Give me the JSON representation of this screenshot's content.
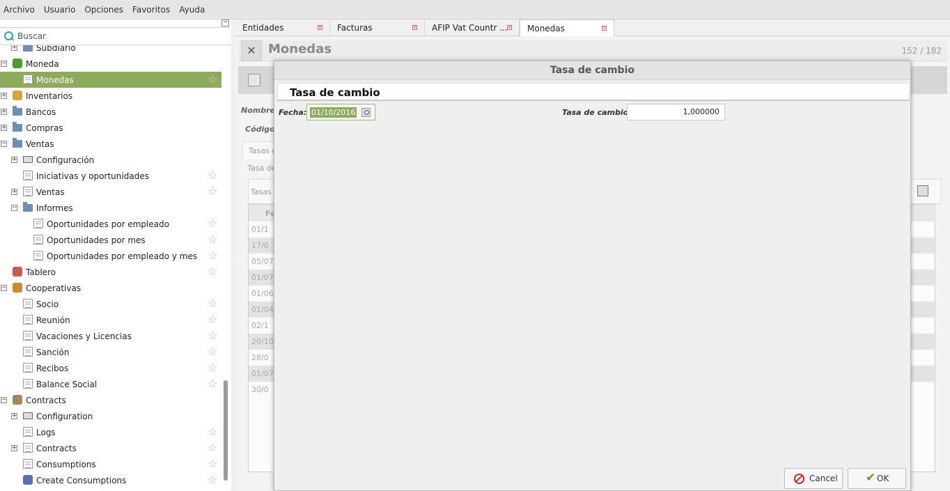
{
  "menu": [
    "Archivo",
    "Usuario",
    "Opciones",
    "Favoritos",
    "Ayuda"
  ],
  "sidebar": {
    "collapse_label": "−",
    "search_placeholder": "Buscar",
    "items": [
      {
        "label": "Subdiario",
        "level": 1,
        "expander": "+",
        "icon": "folder-icon",
        "star": false
      },
      {
        "label": "Moneda",
        "level": 0,
        "expander": "−",
        "icon": "currency-icon",
        "star": false
      },
      {
        "label": "Monedas",
        "level": 1,
        "expander": "",
        "icon": "document-icon",
        "star": true,
        "selected": true
      },
      {
        "label": "Inventarios",
        "level": 0,
        "expander": "+",
        "icon": "box-icon",
        "star": false
      },
      {
        "label": "Bancos",
        "level": 0,
        "expander": "+",
        "icon": "folder-icon",
        "star": false
      },
      {
        "label": "Compras",
        "level": 0,
        "expander": "+",
        "icon": "folder-icon",
        "star": false
      },
      {
        "label": "Ventas",
        "level": 0,
        "expander": "−",
        "icon": "folder-icon",
        "star": false
      },
      {
        "label": "Configuración",
        "level": 1,
        "expander": "+",
        "icon": "config-icon",
        "star": false
      },
      {
        "label": "Iniciativas y oportunidades",
        "level": 1,
        "expander": "",
        "icon": "document-icon",
        "star": true
      },
      {
        "label": "Ventas",
        "level": 1,
        "expander": "+",
        "icon": "document-icon",
        "star": true
      },
      {
        "label": "Informes",
        "level": 1,
        "expander": "−",
        "icon": "folder-icon",
        "star": false
      },
      {
        "label": "Oportunidades por empleado",
        "level": 2,
        "expander": "",
        "icon": "document-icon",
        "star": true
      },
      {
        "label": "Oportunidades por mes",
        "level": 2,
        "expander": "",
        "icon": "document-icon",
        "star": true
      },
      {
        "label": "Oportunidades por empleado y mes",
        "level": 2,
        "expander": "",
        "icon": "document-icon",
        "star": true
      },
      {
        "label": "Tablero",
        "level": 0,
        "expander": "",
        "icon": "board-icon",
        "star": true
      },
      {
        "label": "Cooperativas",
        "level": 0,
        "expander": "−",
        "icon": "people-icon",
        "star": false
      },
      {
        "label": "Socio",
        "level": 1,
        "expander": "",
        "icon": "document-icon",
        "star": true
      },
      {
        "label": "Reunión",
        "level": 1,
        "expander": "",
        "icon": "document-icon",
        "star": true
      },
      {
        "label": "Vacaciones y Licencias",
        "level": 1,
        "expander": "",
        "icon": "document-icon",
        "star": true
      },
      {
        "label": "Sanción",
        "level": 1,
        "expander": "",
        "icon": "document-icon",
        "star": true
      },
      {
        "label": "Recibos",
        "level": 1,
        "expander": "",
        "icon": "document-icon",
        "star": true
      },
      {
        "label": "Balance Social",
        "level": 1,
        "expander": "",
        "icon": "document-icon",
        "star": true
      },
      {
        "label": "Contracts",
        "level": 0,
        "expander": "−",
        "icon": "notepad-icon",
        "star": false
      },
      {
        "label": "Configuration",
        "level": 1,
        "expander": "+",
        "icon": "config-icon",
        "star": false
      },
      {
        "label": "Logs",
        "level": 1,
        "expander": "",
        "icon": "document-icon",
        "star": true
      },
      {
        "label": "Contracts",
        "level": 1,
        "expander": "+",
        "icon": "document-icon",
        "star": true
      },
      {
        "label": "Consumptions",
        "level": 1,
        "expander": "",
        "icon": "document-icon",
        "star": true
      },
      {
        "label": "Create Consumptions",
        "level": 1,
        "expander": "",
        "icon": "wizard-icon",
        "star": true
      }
    ]
  },
  "tabs": [
    {
      "label": "Entidades",
      "active": false
    },
    {
      "label": "Facturas",
      "active": false
    },
    {
      "label": "AFIP Vat Countr ...",
      "active": false
    },
    {
      "label": "Monedas",
      "active": true
    }
  ],
  "background": {
    "title": "Monedas",
    "count": "152 / 182",
    "labels": {
      "nombre": "Nombre",
      "codigo": "Código",
      "tab": "Tasas d",
      "sub": "Tasa de",
      "tasas": "Tasas",
      "col": "Fe"
    },
    "rows": [
      "01/1",
      "17/0",
      "05/07",
      "01/07",
      "01/06",
      "01/04",
      "02/1",
      "20/10",
      "28/0",
      "01/07",
      "30/0"
    ]
  },
  "dialog": {
    "window_title": "Tasa de cambio",
    "heading": "Tasa de cambio",
    "fecha_label": "Fecha:",
    "fecha_value": "01/10/2016",
    "tasa_label": "Tasa de cambio:",
    "tasa_value": "1,000000",
    "cancel_label": "Cancel",
    "ok_label": "OK"
  },
  "colors": {
    "selection": "#8eaa5c",
    "accent_search": "#2aa0c8",
    "cancel_icon": "#cc2222",
    "ok_icon": "#5a9a23"
  }
}
